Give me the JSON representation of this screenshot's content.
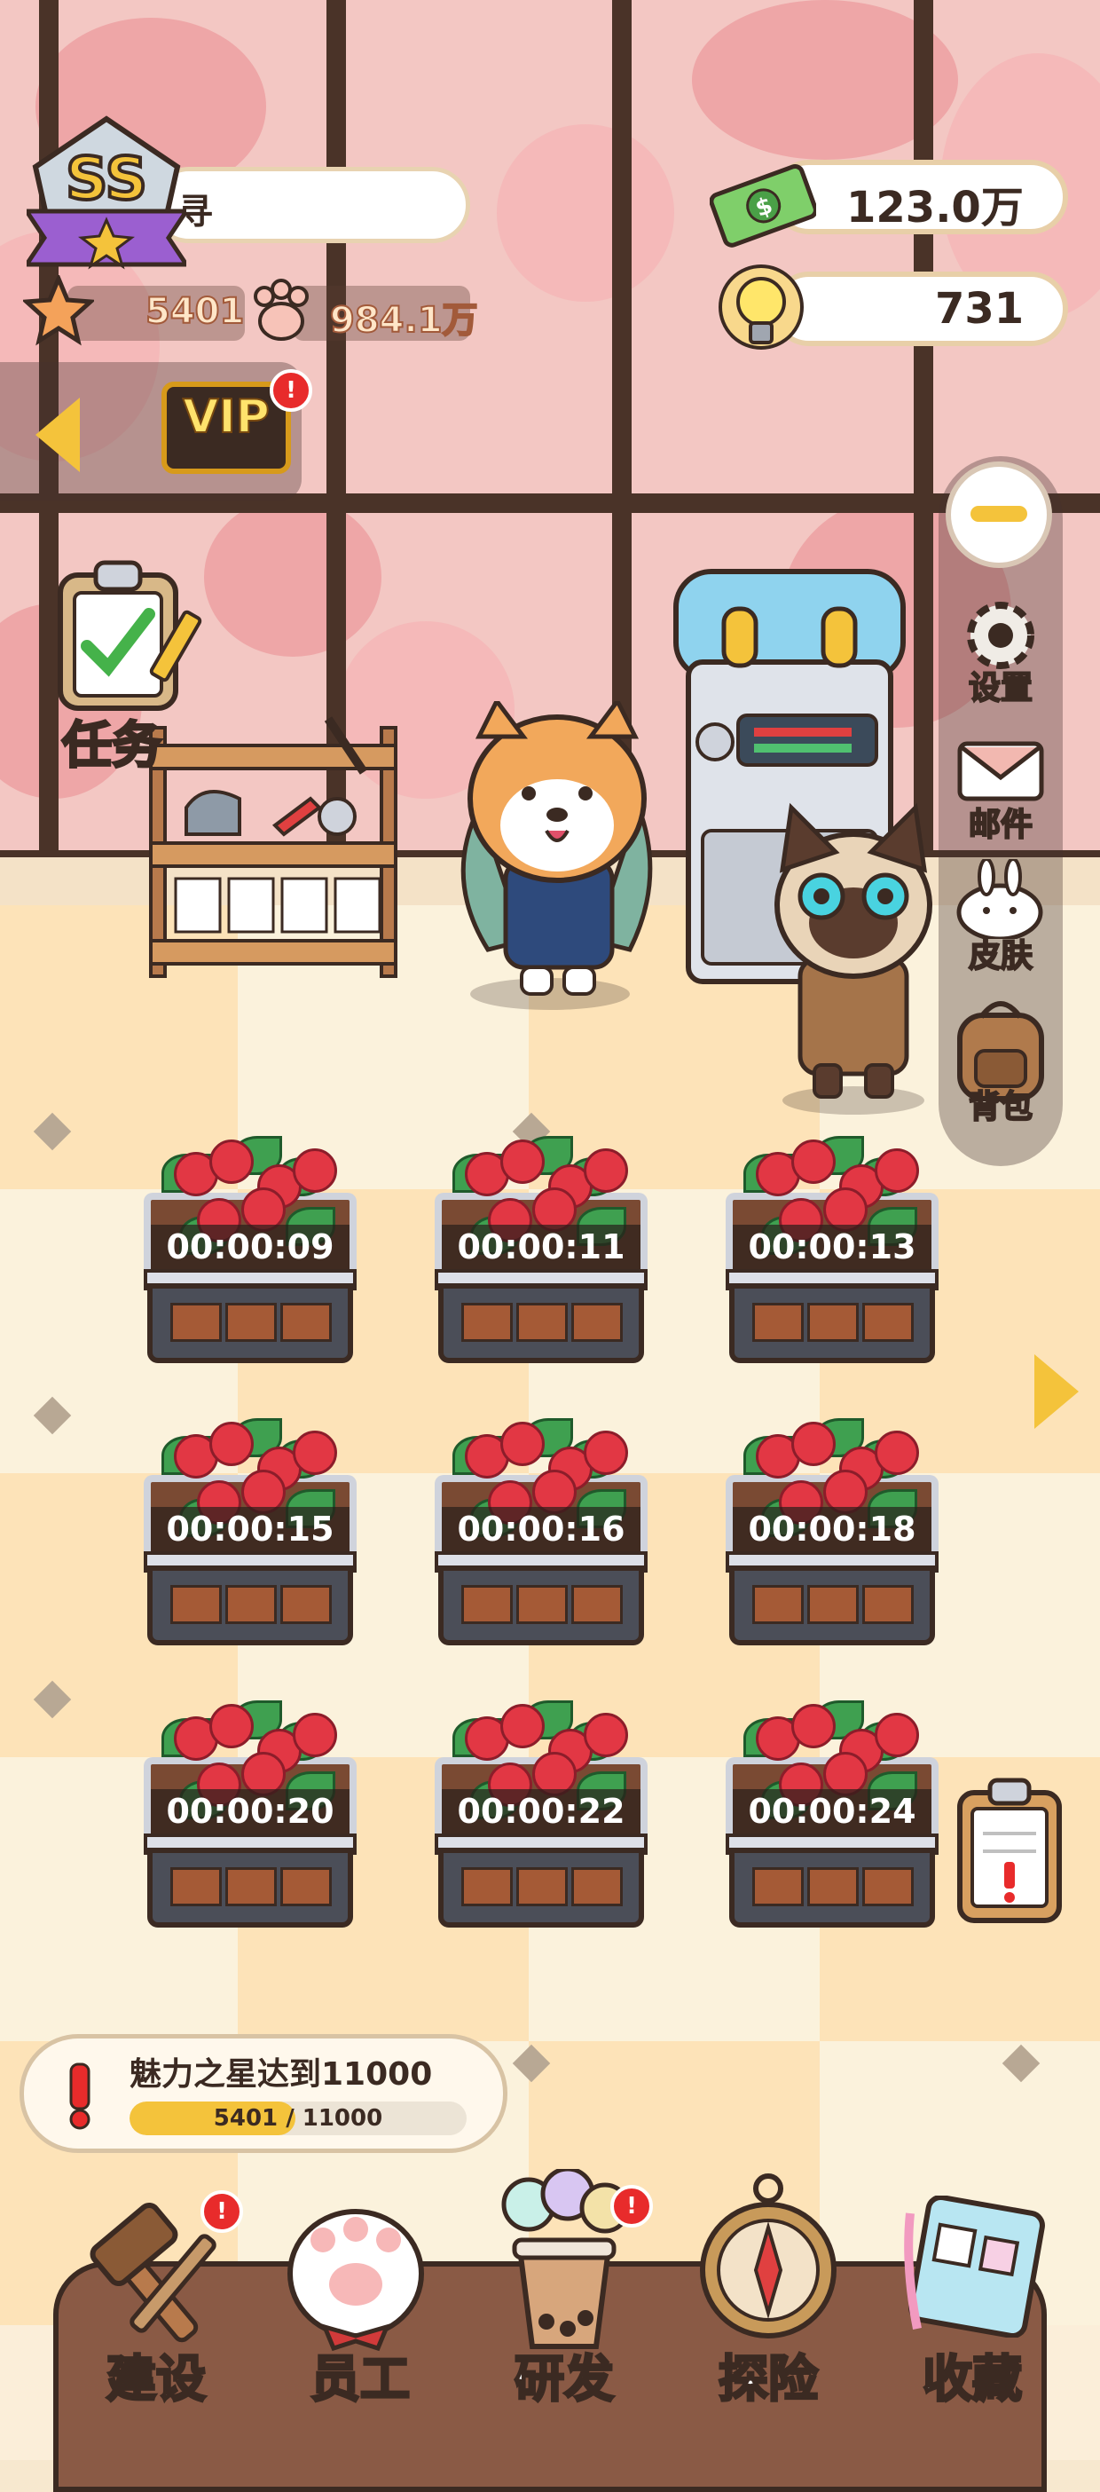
{
  "player": {
    "rank": "SS",
    "name": "寻",
    "star_points": "5401",
    "fans": "984.1万"
  },
  "resources": {
    "cash": "123.0万",
    "ideas": "731"
  },
  "vip": {
    "label": "VIP",
    "badge": "!"
  },
  "task": {
    "label": "任务"
  },
  "side_menu": {
    "items": [
      {
        "label": "设置",
        "icon": "gear-icon"
      },
      {
        "label": "邮件",
        "icon": "mail-icon"
      },
      {
        "label": "皮肤",
        "icon": "bunny-skin-icon"
      },
      {
        "label": "背包",
        "icon": "backpack-icon"
      }
    ]
  },
  "planters": [
    {
      "timer": "00:00:09"
    },
    {
      "timer": "00:00:11"
    },
    {
      "timer": "00:00:13"
    },
    {
      "timer": "00:00:15"
    },
    {
      "timer": "00:00:16"
    },
    {
      "timer": "00:00:18"
    },
    {
      "timer": "00:00:20"
    },
    {
      "timer": "00:00:22"
    },
    {
      "timer": "00:00:24"
    }
  ],
  "goal": {
    "title": "魅力之星达到11000",
    "current": "5401",
    "separator": " / ",
    "target": "11000",
    "progress_fraction": 0.491
  },
  "bottom_nav": {
    "items": [
      {
        "label": "建设",
        "icon": "hammer-brush-icon",
        "badge": "!"
      },
      {
        "label": "员工",
        "icon": "paw-icon",
        "badge": ""
      },
      {
        "label": "研发",
        "icon": "bubble-tea-icon",
        "badge": "!"
      },
      {
        "label": "探险",
        "icon": "compass-icon",
        "badge": ""
      },
      {
        "label": "收藏",
        "icon": "album-icon",
        "badge": ""
      }
    ]
  },
  "colors": {
    "accent_yellow": "#f4c33b",
    "alert_red": "#e82b2b",
    "dark_outline": "#3b2a22",
    "bar_brown": "#8a5a45"
  }
}
